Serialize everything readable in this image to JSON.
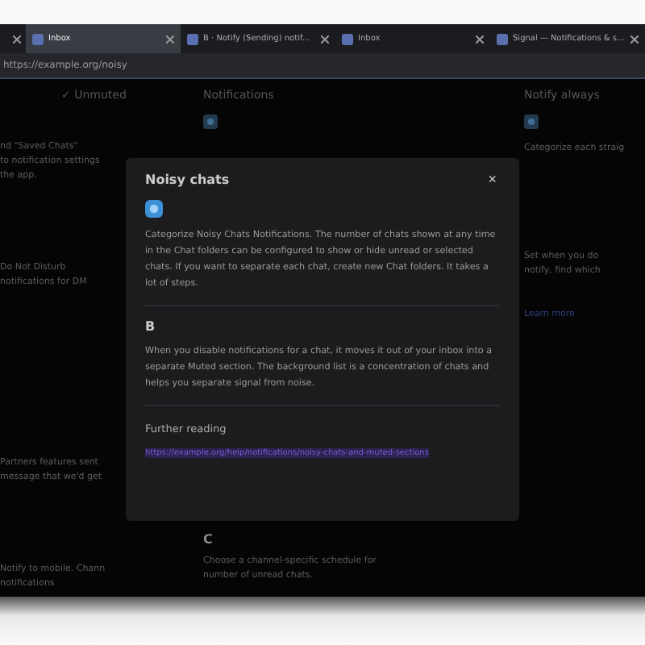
{
  "browser": {
    "tabs": [
      {
        "selected": false
      },
      {
        "title": "Inbox",
        "selected": true
      },
      {
        "title": "B · Notify (Sending) notif...",
        "selected": false
      },
      {
        "title": "Inbox",
        "selected": false
      },
      {
        "title": "Signal — Notifications & s...",
        "selected": false
      }
    ],
    "address": "https://example.org/noisy"
  },
  "columns": [
    {
      "heading": "✓ Unmuted",
      "items": [
        {
          "lines": [
            "nd \"Saved Chats\"",
            "to notification settings",
            "the app."
          ]
        },
        {
          "lines": [
            "Do Not Disturb",
            "notifications for DM"
          ]
        },
        {
          "lines": [
            "Partners features sent",
            "message that we'd get"
          ]
        },
        {
          "lines": [
            "Notify to mobile. Chann",
            "notifications"
          ]
        }
      ]
    },
    {
      "heading": "Notifications",
      "items": [
        {
          "letter": "C",
          "lines": [
            "Choose a channel-specific schedule for",
            "number of unread chats."
          ]
        }
      ]
    },
    {
      "heading": "Notify always",
      "items": [
        {
          "lines": [
            "Categorize each straig"
          ]
        },
        {
          "lines": [
            "Set when you do",
            "notify, find which"
          ]
        },
        {
          "link": "Learn more"
        }
      ]
    }
  ],
  "modal": {
    "title": "Noisy chats",
    "close": "×",
    "sections": [
      {
        "kind": "icon",
        "text": "Categorize Noisy Chats Notifications. The number of chats shown at any time in the Chat folders can be configured to show or hide unread or selected chats. If you want to separate each chat, create new Chat folders. It takes a lot of steps."
      },
      {
        "kind": "letter",
        "letter": "B",
        "text": "When you disable notifications for a chat, it moves it out of your inbox into a separate Muted section. The background list is a concentration of chats and helps you separate signal from noise."
      }
    ],
    "further_heading": "Further reading",
    "link": "https://example.org/help/notifications/noisy-chats-and-muted-sections"
  }
}
